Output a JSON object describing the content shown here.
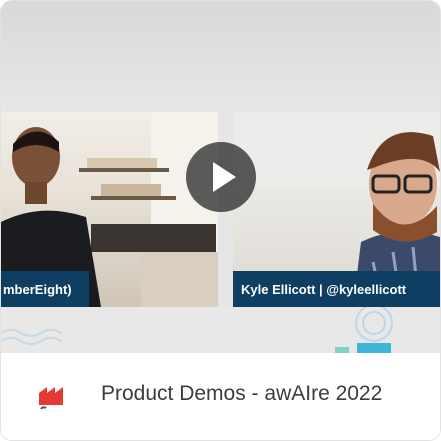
{
  "video": {
    "speaker_left": "mberEight)",
    "speaker_right": "Kyle Ellicott | @kyleellicott"
  },
  "card": {
    "title": "Product Demos - awAIre 2022"
  },
  "icons": {
    "play": "play-icon",
    "app": "app-logo-icon"
  },
  "colors": {
    "banner": "#0e3f63",
    "play_bg": "#1e1e1e",
    "app_icon": "#e53935"
  }
}
